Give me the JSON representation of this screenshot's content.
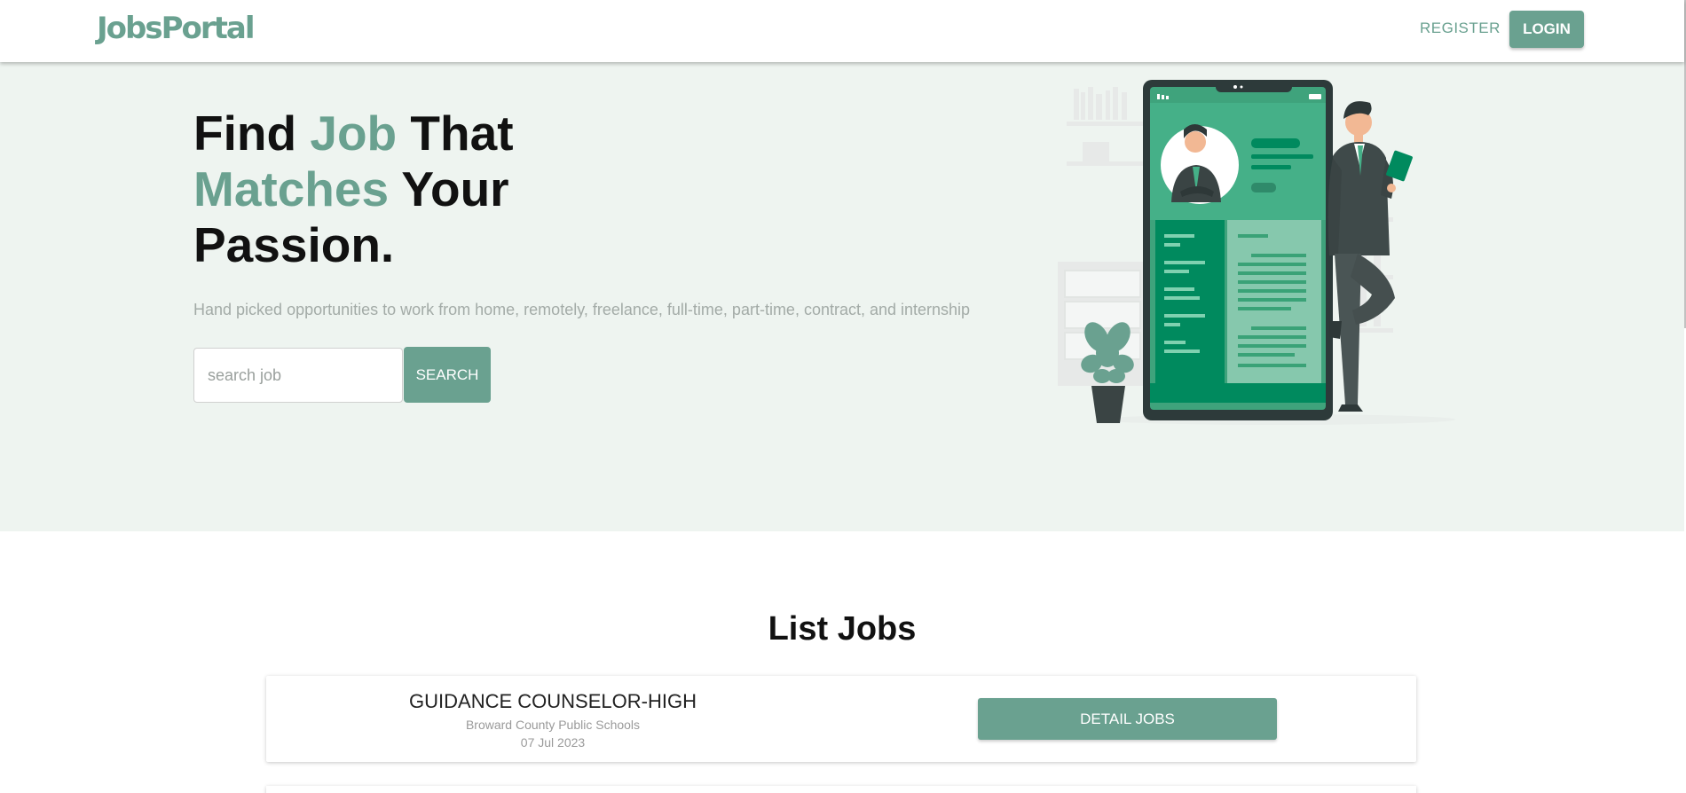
{
  "nav": {
    "logo": "JobsPortal",
    "register_label": "REGISTER",
    "login_label": "LOGIN"
  },
  "hero": {
    "title_part1": "Find ",
    "title_accent1": "Job",
    "title_part2": " That",
    "title_accent2": "Matches",
    "title_part3": " Your",
    "title_part4": "Passion.",
    "subtitle": "Hand picked opportunities to work from home, remotely, freelance, full-time, part-time, contract, and internship",
    "search_placeholder": "search job",
    "search_value": "",
    "search_button": "SEARCH"
  },
  "jobs": {
    "heading": "List Jobs",
    "items": [
      {
        "title": "GUIDANCE COUNSELOR-HIGH",
        "company": "Broward County Public Schools",
        "date": "07 Jul 2023",
        "button": "DETAIL JOBS"
      }
    ]
  },
  "colors": {
    "accent": "#6aa190",
    "hero_bg": "#eef4f0",
    "phone_green": "#008a5e"
  },
  "icons": {
    "illustration": "man-with-phone-resume-illustration"
  }
}
